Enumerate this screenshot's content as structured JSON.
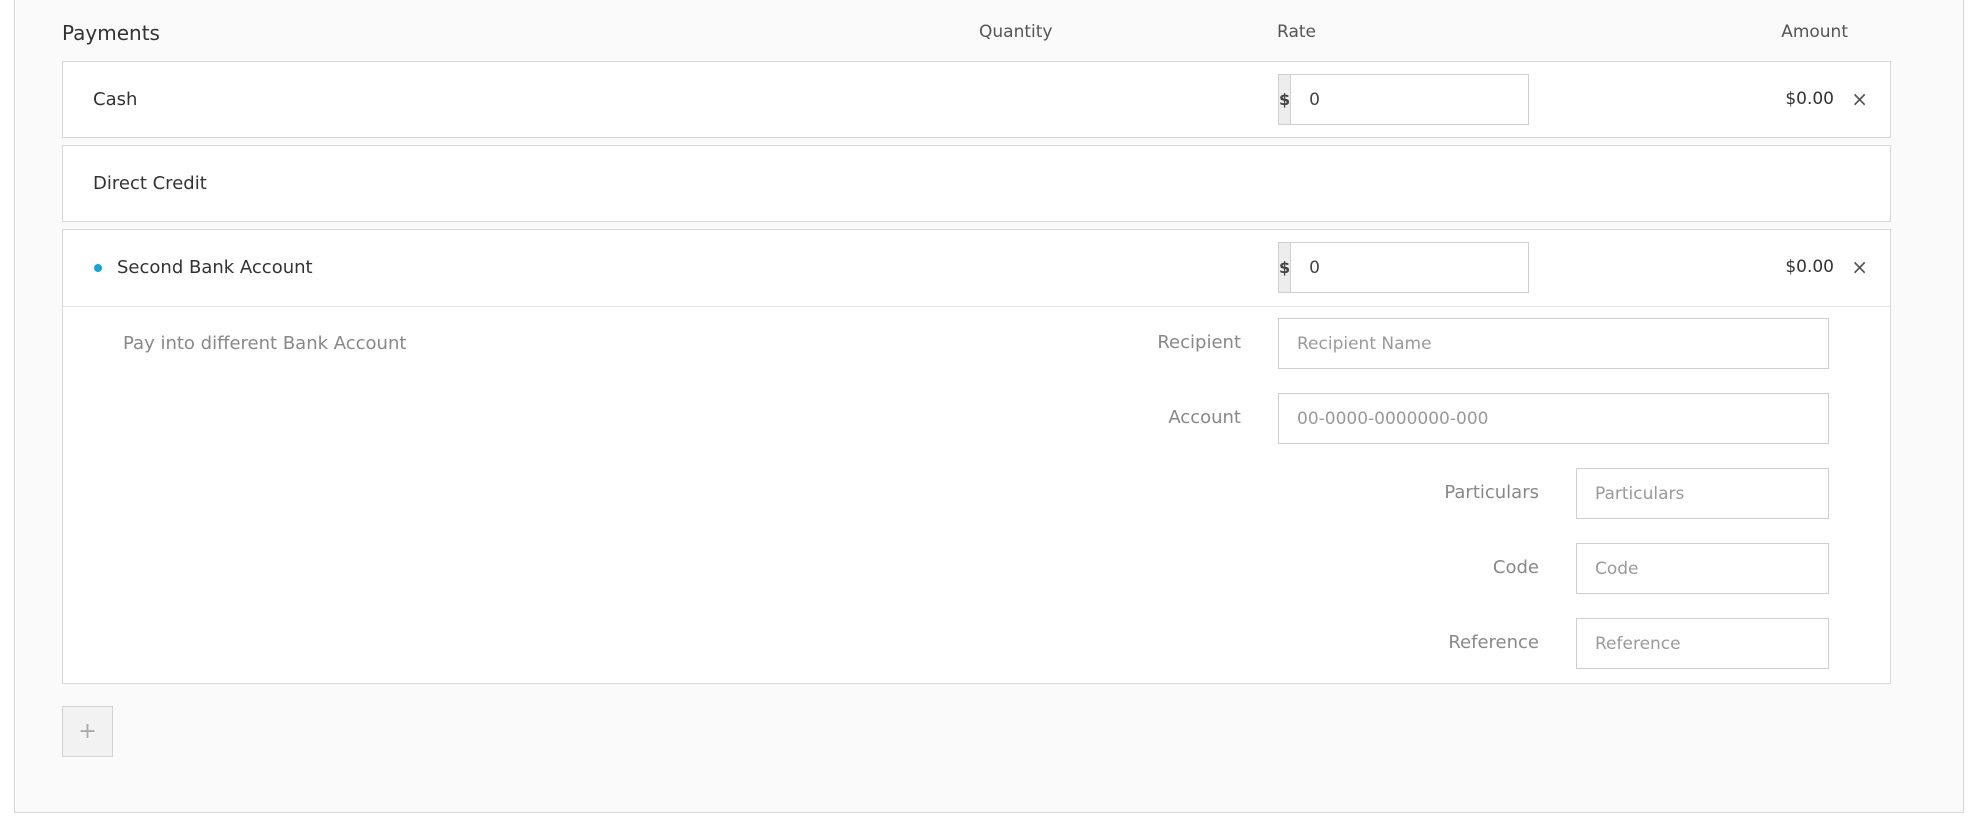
{
  "header": {
    "title": "Payments",
    "quantity_label": "Quantity",
    "rate_label": "Rate",
    "amount_label": "Amount"
  },
  "payments": [
    {
      "name": "Cash",
      "currency": "$",
      "rate": "0",
      "amount": "$0.00",
      "remove": "×"
    },
    {
      "name": "Direct Credit"
    },
    {
      "name": "Second Bank Account",
      "currency": "$",
      "rate": "0",
      "amount": "$0.00",
      "remove": "×",
      "description": "Pay into different Bank Account",
      "fields": {
        "recipient": {
          "label": "Recipient",
          "placeholder": "Recipient Name"
        },
        "account": {
          "label": "Account",
          "placeholder": "00-0000-0000000-000"
        },
        "particulars": {
          "label": "Particulars",
          "placeholder": "Particulars"
        },
        "code": {
          "label": "Code",
          "placeholder": "Code"
        },
        "reference": {
          "label": "Reference",
          "placeholder": "Reference"
        }
      }
    }
  ],
  "add_button": "+",
  "colors": {
    "accent_bullet": "#14a5dd"
  }
}
